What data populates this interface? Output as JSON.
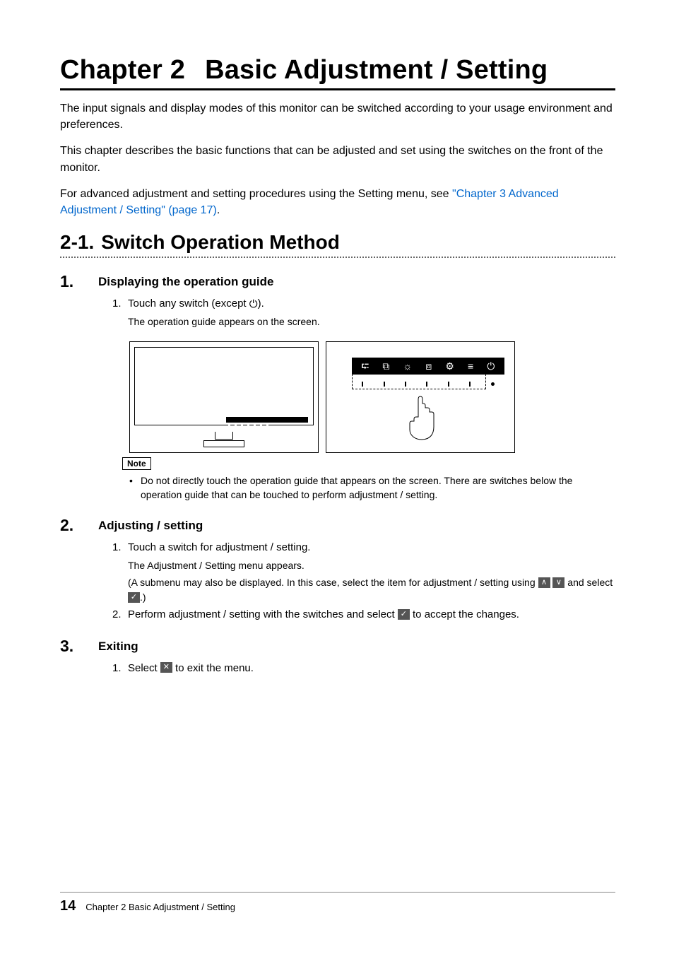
{
  "chapter": {
    "number": "Chapter 2",
    "title": "Basic Adjustment / Setting"
  },
  "intro": {
    "p1": "The input signals and display modes of this monitor can be switched according to your usage environment and preferences.",
    "p2": "This chapter describes the basic functions that can be adjusted and set using the switches on the front of the monitor.",
    "p3_before": "For advanced adjustment and setting procedures using the Setting menu, see ",
    "p3_link": "\"Chapter 3 Advanced Adjustment / Setting\" (page 17)",
    "p3_after": "."
  },
  "section": {
    "number": "2-1.",
    "title": "Switch Operation Method"
  },
  "steps": [
    {
      "num": "1.",
      "title": "Displaying the operation guide",
      "items": [
        {
          "text_before": "Touch any switch (except ",
          "icon": "⏻",
          "text_after": ").",
          "sub": "The operation guide appears on the screen."
        }
      ]
    },
    {
      "num": "2.",
      "title": "Adjusting / setting",
      "items": [
        {
          "text": "Touch a switch for adjustment / setting.",
          "sub": "The Adjustment / Setting menu appears.",
          "sub2_a": "(A submenu may also be displayed. In this case, select the item for adjustment / setting using ",
          "sub2_b": " and select ",
          "sub2_c": ".)"
        },
        {
          "text_before": "Perform adjustment / setting with the switches and select ",
          "text_after": " to accept the changes."
        }
      ]
    },
    {
      "num": "3.",
      "title": "Exiting",
      "items": [
        {
          "text_before": "Select ",
          "text_after": " to exit the menu."
        }
      ]
    }
  ],
  "note": {
    "label": "Note",
    "text": "Do not directly touch the operation guide that appears on the screen. There are switches below the operation guide that can be touched to perform adjustment / setting."
  },
  "icons": {
    "up": "∧",
    "down": "∨",
    "check": "✓",
    "close": "✕",
    "power_inline": "⏻"
  },
  "guide_bar_glyphs": [
    "⮓",
    "⧉",
    "☼",
    "⧈",
    "⚙",
    "≡",
    "⏻"
  ],
  "footer": {
    "page": "14",
    "label": "Chapter 2 Basic Adjustment / Setting"
  }
}
